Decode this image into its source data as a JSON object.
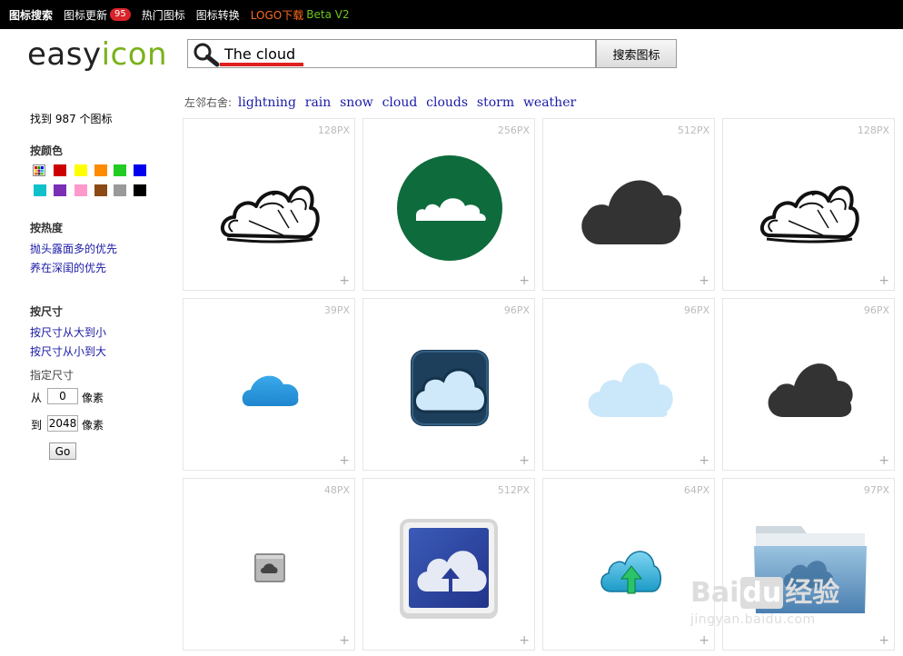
{
  "topnav": {
    "items": [
      "图标搜索",
      "图标更新",
      "热门图标",
      "图标转换"
    ],
    "update_badge": "95",
    "logo_download": "LOGO下载",
    "beta": "Beta V2"
  },
  "logo": {
    "part1": "easy",
    "part2": "icon"
  },
  "search": {
    "value": "The cloud",
    "button": "搜索图标"
  },
  "related": {
    "label": "左邻右舍:",
    "links": [
      "lightning",
      "rain",
      "snow",
      "cloud",
      "clouds",
      "storm",
      "weather"
    ]
  },
  "sidebar": {
    "found": "找到 987 个图标",
    "color_heading": "按颜色",
    "colors": [
      "multi",
      "#cc0000",
      "#ffff00",
      "#ff8c00",
      "#22cc22",
      "#0000ee",
      "#11c1c9",
      "#7b2fb5",
      "#ff99cc",
      "#8b4a13",
      "#999999",
      "#000000"
    ],
    "popularity_heading": "按热度",
    "popularity_links": [
      "抛头露面多的优先",
      "养在深闺的优先"
    ],
    "size_heading": "按尺寸",
    "size_links": [
      "按尺寸从大到小",
      "按尺寸从小到大"
    ],
    "custom_size": "指定尺寸",
    "from_label": "从",
    "from_value": "0",
    "to_label": "到",
    "to_value": "2048",
    "unit": "像素",
    "go": "Go"
  },
  "results": [
    {
      "size": "128PX",
      "icon": "sketch-cloud-icon"
    },
    {
      "size": "256PX",
      "icon": "green-circle-cloud-icon"
    },
    {
      "size": "512PX",
      "icon": "dark-cloud-icon"
    },
    {
      "size": "128PX",
      "icon": "sketch-cloud-icon"
    },
    {
      "size": "39PX",
      "icon": "blue-cloud-icon"
    },
    {
      "size": "96PX",
      "icon": "navy-square-cloud-icon"
    },
    {
      "size": "96PX",
      "icon": "light-blue-cloud-icon"
    },
    {
      "size": "96PX",
      "icon": "dark-cloud-icon"
    },
    {
      "size": "48PX",
      "icon": "grey-cloud-app-icon"
    },
    {
      "size": "512PX",
      "icon": "blue-cloud-upload-icon"
    },
    {
      "size": "64PX",
      "icon": "cyan-cloud-upload-icon"
    },
    {
      "size": "97PX",
      "icon": "cloud-folder-icon"
    }
  ],
  "plus_label": "+",
  "watermark": {
    "brand": "Bai",
    "brand2": "du",
    "site": "经验",
    "url": "jingyan.baidu.com"
  }
}
